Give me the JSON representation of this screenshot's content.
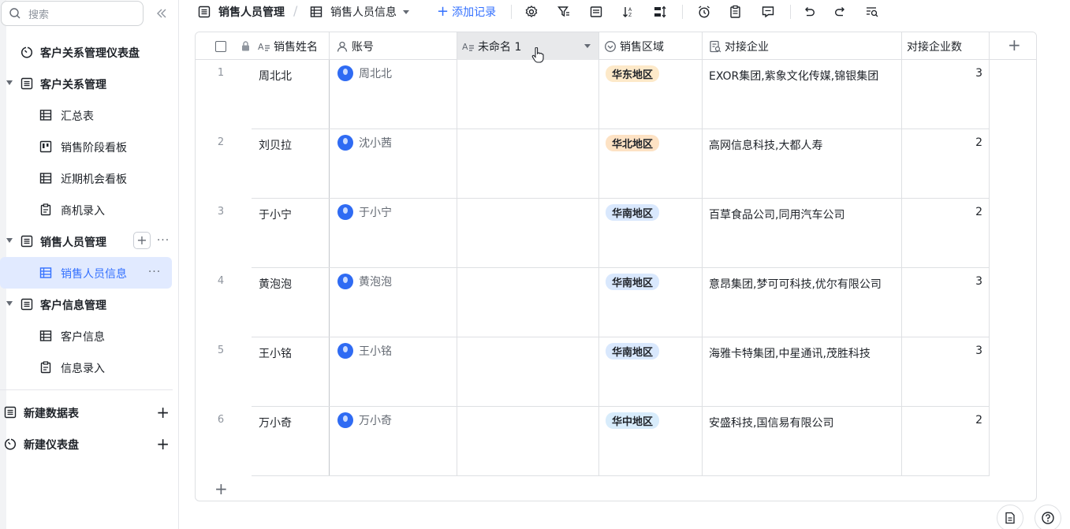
{
  "sidebar": {
    "search_placeholder": "搜索",
    "items": [
      {
        "label": "客户关系管理仪表盘",
        "icon": "dashboard-icon"
      },
      {
        "label": "客户关系管理",
        "icon": "folder-table-icon"
      },
      {
        "label": "汇总表",
        "icon": "grid-icon"
      },
      {
        "label": "销售阶段看板",
        "icon": "kanban-icon"
      },
      {
        "label": "近期机会看板",
        "icon": "grid-icon"
      },
      {
        "label": "商机录入",
        "icon": "form-icon"
      },
      {
        "label": "销售人员管理",
        "icon": "folder-table-icon"
      },
      {
        "label": "销售人员信息",
        "icon": "grid-icon"
      },
      {
        "label": "客户信息管理",
        "icon": "folder-table-icon"
      },
      {
        "label": "客户信息",
        "icon": "grid-icon"
      },
      {
        "label": "信息录入",
        "icon": "form-icon"
      }
    ],
    "new_table": "新建数据表",
    "new_dashboard": "新建仪表盘"
  },
  "toolbar": {
    "crumb_folder": "销售人员管理",
    "crumb_table": "销售人员信息",
    "add_record": "添加记录",
    "icons": [
      "settings-icon",
      "filter-icon",
      "group-icon",
      "sort-icon",
      "row-height-icon",
      "alarm-icon",
      "clipboard-icon",
      "comment-icon",
      "undo-icon",
      "redo-icon",
      "search-filter-icon"
    ]
  },
  "table": {
    "columns": [
      "销售姓名",
      "账号",
      "未命名 1",
      "销售区域",
      "对接企业",
      "对接企业数"
    ],
    "rows": [
      {
        "num": "1",
        "name": "周北北",
        "account": "周北北",
        "unnamed": "",
        "region": "华东地区",
        "companies": "EXOR集团,紫象文化传媒,锦银集团",
        "count": "3"
      },
      {
        "num": "2",
        "name": "刘贝拉",
        "account": "沈小茜",
        "unnamed": "",
        "region": "华北地区",
        "companies": "高网信息科技,大都人寿",
        "count": "2"
      },
      {
        "num": "3",
        "name": "于小宁",
        "account": "于小宁",
        "unnamed": "",
        "region": "华南地区",
        "companies": "百草食品公司,同用汽车公司",
        "count": "2"
      },
      {
        "num": "4",
        "name": "黄泡泡",
        "account": "黄泡泡",
        "unnamed": "",
        "region": "华南地区",
        "companies": "意昂集团,梦可可科技,优尔有限公司",
        "count": "3"
      },
      {
        "num": "5",
        "name": "王小铭",
        "account": "王小铭",
        "unnamed": "",
        "region": "华南地区",
        "companies": "海雅卡特集团,中星通讯,茂胜科技",
        "count": "3"
      },
      {
        "num": "6",
        "name": "万小奇",
        "account": "万小奇",
        "unnamed": "",
        "region": "华中地区",
        "companies": "安盛科技,国信易有限公司",
        "count": "2"
      }
    ],
    "region_colors": {
      "华东地区": "#fde9c9",
      "华北地区": "#fde2c4",
      "华南地区": "#d9e8fd",
      "华中地区": "#d8ecfb"
    }
  }
}
